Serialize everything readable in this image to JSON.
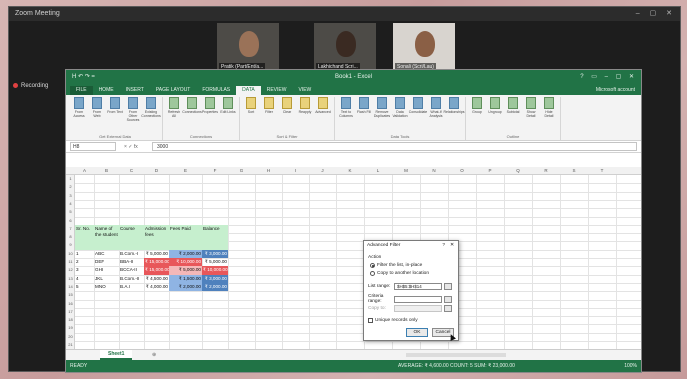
{
  "zoom": {
    "window_title": "Zoom Meeting",
    "recording_label": "Recording",
    "participants": [
      {
        "name": "Pratik (Part/Ent/a..."
      },
      {
        "name": "Lakhichand Scri..."
      },
      {
        "name": "Sonali (Scri/Lau)"
      }
    ]
  },
  "excel": {
    "window_title": "Book1 - Excel",
    "quick_access": "H  ↶  ↷  =",
    "window_controls": "? ▭ – ▢ ✕",
    "ribbon_tabs": [
      "FILE",
      "HOME",
      "INSERT",
      "PAGE LAYOUT",
      "FORMULAS",
      "DATA",
      "REVIEW",
      "VIEW"
    ],
    "active_tab": "DATA",
    "user_account": "Microsoft account",
    "ribbon_groups": [
      {
        "name": "Get External Data",
        "buttons": [
          "From Access",
          "From Web",
          "From Text",
          "From Other Sources",
          "Existing Connections"
        ],
        "icon_tone": "blue"
      },
      {
        "name": "Connections",
        "buttons": [
          "Refresh All",
          "Connections",
          "Properties",
          "Edit Links"
        ],
        "icon_tone": "green"
      },
      {
        "name": "Sort & Filter",
        "buttons": [
          "Sort",
          "Filter",
          "Clear",
          "Reapply",
          "Advanced"
        ],
        "icon_tone": "yellow"
      },
      {
        "name": "Data Tools",
        "buttons": [
          "Text to Columns",
          "Flash Fill",
          "Remove Duplicates",
          "Data Validation",
          "Consolidate",
          "What-If Analysis",
          "Relationships"
        ],
        "icon_tone": "blue"
      },
      {
        "name": "Outline",
        "buttons": [
          "Group",
          "Ungroup",
          "Subtotal",
          "Show Detail",
          "Hide Detail"
        ],
        "icon_tone": "green"
      }
    ],
    "name_box": "H8",
    "fx_label": "× ✓ fx",
    "formula_value": "3000",
    "columns": [
      "A",
      "B",
      "C",
      "D",
      "E",
      "F",
      "G",
      "H",
      "I",
      "J",
      "K",
      "L",
      "M",
      "N",
      "O",
      "P",
      "Q",
      "R",
      "S",
      "T"
    ],
    "rows": [
      "1",
      "2",
      "3",
      "4",
      "5",
      "6",
      "7",
      "8",
      "9",
      "10",
      "11",
      "12",
      "13",
      "14",
      "15",
      "16",
      "17",
      "18",
      "19",
      "20",
      "21"
    ],
    "table": {
      "headers": [
        "Sr. No.",
        "Name of the student",
        "Course",
        "Admission fees",
        "Fees Paid",
        "Balance"
      ],
      "rows": [
        {
          "sr": "1",
          "name": "ABC",
          "course": "B.Com.-I",
          "fees": "₹ 5,000.00",
          "paid": "₹ 2,000.00",
          "balance": "₹ 3,000.00",
          "fees_tone": "plain",
          "paid_tone": "blue",
          "bal_tone": "dblue"
        },
        {
          "sr": "2",
          "name": "DEF",
          "course": "BBA-II",
          "fees": "₹ 15,000.00",
          "paid": "₹ 10,000.00",
          "balance": "₹ 5,000.00",
          "fees_tone": "red",
          "paid_tone": "red",
          "bal_tone": "plain"
        },
        {
          "sr": "3",
          "name": "GHI",
          "course": "BCCA-II",
          "fees": "₹ 15,000.00",
          "paid": "₹ 5,000.00",
          "balance": "₹ 10,000.00",
          "fees_tone": "red",
          "paid_tone": "pink",
          "bal_tone": "red"
        },
        {
          "sr": "4",
          "name": "JKL",
          "course": "B.Com.-II",
          "fees": "₹ 4,500.00",
          "paid": "₹ 1,500.00",
          "balance": "₹ 3,000.00",
          "fees_tone": "plain",
          "paid_tone": "blue",
          "bal_tone": "dblue"
        },
        {
          "sr": "5",
          "name": "MNO",
          "course": "B.A.I",
          "fees": "₹ 4,000.00",
          "paid": "₹ 2,000.00",
          "balance": "₹ 2,000.00",
          "fees_tone": "plain",
          "paid_tone": "blue",
          "bal_tone": "dblue"
        }
      ]
    },
    "sheet_tab": "Sheet1",
    "status_ready": "READY",
    "status_stats": "AVERAGE: ₹ 4,600.00   COUNT: 5   SUM: ₹ 23,000.00",
    "zoom_level": "100%"
  },
  "dialog": {
    "title": "Advanced Filter",
    "help": "?",
    "close": "✕",
    "action_label": "Action",
    "option_inplace": "Filter the list, in-place",
    "option_copy": "Copy to another location",
    "list_range_label": "List range:",
    "list_range_value": "$H$5:$H$14",
    "criteria_range_label": "Criteria range:",
    "criteria_range_value": "",
    "copy_to_label": "Copy to:",
    "copy_to_value": "",
    "unique_label": "Unique records only",
    "ok": "OK",
    "cancel": "Cancel"
  },
  "colors": {
    "excel_green": "#217346",
    "header_green": "#c6efce",
    "red": "#e8575a",
    "pink": "#f4b8b8",
    "blue": "#8fb4e3",
    "dark_blue": "#4f81bd"
  }
}
